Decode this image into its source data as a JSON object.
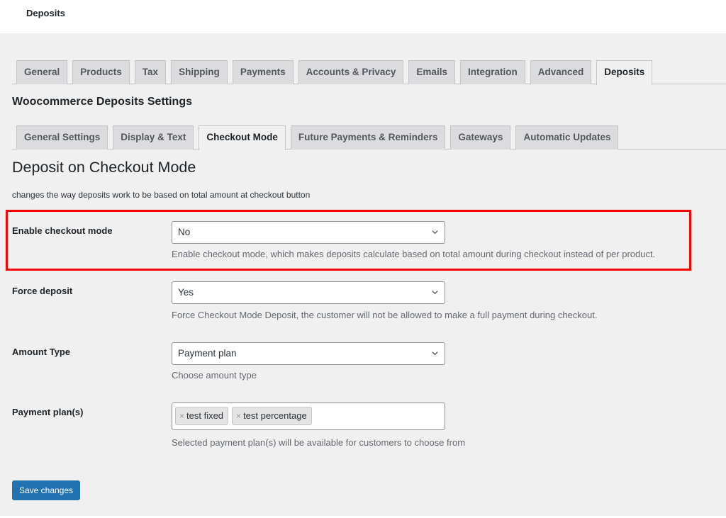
{
  "topbar": {
    "title": "Deposits"
  },
  "main_tabs": [
    {
      "label": "General"
    },
    {
      "label": "Products"
    },
    {
      "label": "Tax"
    },
    {
      "label": "Shipping"
    },
    {
      "label": "Payments"
    },
    {
      "label": "Accounts & Privacy"
    },
    {
      "label": "Emails"
    },
    {
      "label": "Integration"
    },
    {
      "label": "Advanced"
    },
    {
      "label": "Deposits",
      "active": true
    }
  ],
  "section_title": "Woocommerce Deposits Settings",
  "sub_tabs": [
    {
      "label": "General Settings"
    },
    {
      "label": "Display & Text"
    },
    {
      "label": "Checkout Mode",
      "active": true
    },
    {
      "label": "Future Payments & Reminders"
    },
    {
      "label": "Gateways"
    },
    {
      "label": "Automatic Updates"
    }
  ],
  "page": {
    "heading": "Deposit on Checkout Mode",
    "description": "changes the way deposits work to be based on total amount at checkout button"
  },
  "fields": {
    "checkout_mode": {
      "label": "Enable checkout mode",
      "value": "No",
      "help": "Enable checkout mode, which makes deposits calculate based on total amount during checkout instead of per product."
    },
    "force_deposit": {
      "label": "Force deposit",
      "value": "Yes",
      "help": "Force Checkout Mode Deposit, the customer will not be allowed to make a full payment during checkout."
    },
    "amount_type": {
      "label": "Amount Type",
      "value": "Payment plan",
      "help": "Choose amount type"
    },
    "payment_plans": {
      "label": "Payment plan(s)",
      "chips": [
        {
          "label": "test fixed",
          "remove": "×"
        },
        {
          "label": "test percentage",
          "remove": "×"
        }
      ],
      "help": "Selected payment plan(s) will be available for customers to choose from"
    }
  },
  "save_label": "Save changes",
  "colors": {
    "highlight": "#ff0000",
    "primary": "#2271b1"
  }
}
